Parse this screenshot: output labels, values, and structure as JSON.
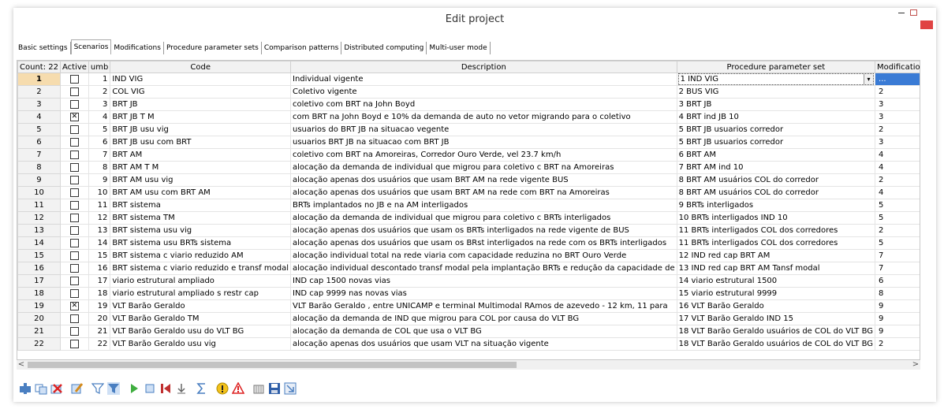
{
  "window": {
    "title": "Edit project"
  },
  "tabs": [
    {
      "label": "Basic settings"
    },
    {
      "label": "Scenarios",
      "active": true
    },
    {
      "label": "Modifications"
    },
    {
      "label": "Procedure parameter sets"
    },
    {
      "label": "Comparison patterns"
    },
    {
      "label": "Distributed computing"
    },
    {
      "label": "Multi-user mode"
    }
  ],
  "table": {
    "headers": {
      "count": "Count: 22",
      "active": "Active",
      "number": "umb",
      "code": "Code",
      "description": "Description",
      "param_set": "Procedure parameter set",
      "modifications": "Modifications"
    },
    "selected_modifications": "...",
    "rows": [
      {
        "n": "1",
        "active": false,
        "num": "1",
        "code": "IND VIG",
        "desc": "Individual vigente",
        "pps": "1 IND VIG",
        "mods": ""
      },
      {
        "n": "2",
        "active": false,
        "num": "2",
        "code": "COL VIG",
        "desc": "Coletivo vigente",
        "pps": "2 BUS VIG",
        "mods": "2"
      },
      {
        "n": "3",
        "active": false,
        "num": "3",
        "code": "BRT JB",
        "desc": "coletivo com BRT na John Boyd",
        "pps": "3 BRT JB",
        "mods": "3"
      },
      {
        "n": "4",
        "active": true,
        "num": "4",
        "code": "BRT JB T M",
        "desc": "com BRT na John Boyd e 10% da demanda de auto no vetor migrando para o coletivo",
        "pps": "4 BRT ind JB 10",
        "mods": "3"
      },
      {
        "n": "5",
        "active": false,
        "num": "5",
        "code": "BRT JB usu vig",
        "desc": "usuarios do BRT JB na situacao vegente",
        "pps": "5 BRT JB usuarios corredor",
        "mods": "2"
      },
      {
        "n": "6",
        "active": false,
        "num": "6",
        "code": "BRT JB usu com BRT",
        "desc": "usuarios BRT JB na situacao com BRT JB",
        "pps": "5 BRT JB usuarios corredor",
        "mods": "3"
      },
      {
        "n": "7",
        "active": false,
        "num": "7",
        "code": "BRT AM",
        "desc": "coletivo com BRT na Amoreiras, Corredor Ouro Verde, vel 23.7 km/h",
        "pps": "6 BRT AM",
        "mods": "4"
      },
      {
        "n": "8",
        "active": false,
        "num": "8",
        "code": "BRT AM T M",
        "desc": "alocação da demanda de individual que migrou para coletivo c BRT na Amoreiras",
        "pps": "7 BRT AM ind 10",
        "mods": "4"
      },
      {
        "n": "9",
        "active": false,
        "num": "9",
        "code": "BRT AM usu vig",
        "desc": "alocação apenas dos usuários que usam BRT AM na rede vigente BUS",
        "pps": "8 BRT AM usuários COL do corredor",
        "mods": "2"
      },
      {
        "n": "10",
        "active": false,
        "num": "10",
        "code": "BRT AM usu com BRT AM",
        "desc": "alocação apenas dos usuários que usam BRT AM na rede com BRT na Amoreiras",
        "pps": "8 BRT AM usuários COL do corredor",
        "mods": "4"
      },
      {
        "n": "11",
        "active": false,
        "num": "11",
        "code": "BRT sistema",
        "desc": "BRTs implantados no JB e na AM interligados",
        "pps": "9 BRTs interligados",
        "mods": "5"
      },
      {
        "n": "12",
        "active": false,
        "num": "12",
        "code": "BRT sistema TM",
        "desc": "alocação da demanda de individual que migrou para coletivo c BRTs interligados",
        "pps": "10 BRTs interligados IND 10",
        "mods": "5"
      },
      {
        "n": "13",
        "active": false,
        "num": "13",
        "code": "BRT sistema usu vig",
        "desc": "alocação apenas dos usuários que usam os BRTs interligados na rede vigente de BUS",
        "pps": "11 BRTs interligados COL dos corredores",
        "mods": "2"
      },
      {
        "n": "14",
        "active": false,
        "num": "14",
        "code": "BRT sistema usu BRTs sistema",
        "desc": "alocação apenas dos usuários que usam os BRst interligados na rede com os BRTs interligados",
        "pps": "11 BRTs interligados COL dos corredores",
        "mods": "5"
      },
      {
        "n": "15",
        "active": false,
        "num": "15",
        "code": "BRT sistema c viario reduzido AM",
        "desc": "alocação individual total na rede viaria com capacidade reduzina no BRT Ouro Verde",
        "pps": "12 IND red cap BRT AM",
        "mods": "7"
      },
      {
        "n": "16",
        "active": false,
        "num": "16",
        "code": "BRT sistema c viario reduzido e transf modal",
        "desc": "alocação individual descontado transf modal pela implantação BRTs e redução da capacidade de",
        "pps": "13 IND red cap BRT AM Tansf modal",
        "mods": "7"
      },
      {
        "n": "17",
        "active": false,
        "num": "17",
        "code": "viario estrutural ampliado",
        "desc": "IND cap 1500 novas vias",
        "pps": "14 viario estrutural 1500",
        "mods": "6"
      },
      {
        "n": "18",
        "active": false,
        "num": "18",
        "code": "viario estrutural ampliado s restr cap",
        "desc": "IND cap 9999 nas novas vias",
        "pps": "15 viario estrutural 9999",
        "mods": "8"
      },
      {
        "n": "19",
        "active": true,
        "num": "19",
        "code": "VLT Barão Geraldo",
        "desc": "VLT Barão Geraldo , entre UNICAMP e terminal Multimodal RAmos de azevedo - 12 km, 11 para",
        "pps": "16 VLT Barão Geraldo",
        "mods": "9"
      },
      {
        "n": "20",
        "active": false,
        "num": "20",
        "code": "VLT Barão Geraldo TM",
        "desc": "alocação da demanda de IND que migrou para COL por causa do VLT BG",
        "pps": "17 VLT Barão Geraldo IND 15",
        "mods": "9"
      },
      {
        "n": "21",
        "active": false,
        "num": "21",
        "code": "VLT Barão Geraldo usu do VLT BG",
        "desc": "alocação da demanda de COL que usa o VLT BG",
        "pps": "18 VLT Barão Geraldo usuários de COL do VLT BG",
        "mods": "9"
      },
      {
        "n": "22",
        "active": false,
        "num": "22",
        "code": "VLT Barão Geraldo usu vig",
        "desc": "alocação apenas dos usuários que usam VLT na situação vigente",
        "pps": "18 VLT Barão Geraldo usuários de COL do VLT BG",
        "mods": "2"
      }
    ]
  },
  "scrollbar": {
    "left_arrow": "<",
    "right_arrow": ">"
  },
  "toolbar_icons": [
    "create-icon",
    "duplicate-icon",
    "delete-icon",
    "edit-icon",
    "filter-icon",
    "filter-active-icon",
    "run-icon",
    "stop-icon",
    "reset-icon",
    "import-icon",
    "sum-icon",
    "info-icon",
    "warning-icon",
    "archive-icon",
    "save-icon",
    "export-icon"
  ],
  "colors": {
    "selected_row_header": "#f6dcae",
    "selected_cell": "#3a7bd5",
    "close_button": "#e04343"
  }
}
